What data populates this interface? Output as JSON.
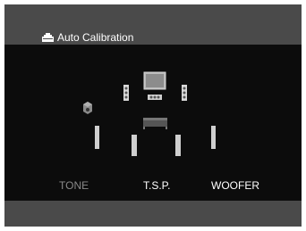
{
  "header": {
    "title": "Auto Calibration",
    "icon": "calibration-icon"
  },
  "speaker_layout": {
    "speakers": [
      "tv",
      "front-left",
      "front-right",
      "center",
      "front-high-left",
      "subwoofer",
      "surround-left",
      "surround-right",
      "surround-back-left",
      "surround-back-right",
      "listening-position"
    ]
  },
  "menu": {
    "items": [
      {
        "label": "TONE",
        "state": "dim"
      },
      {
        "label": "T.S.P.",
        "state": "active"
      },
      {
        "label": "WOOFER",
        "state": "active"
      }
    ]
  },
  "colors": {
    "header_bg": "#4a4a4a",
    "screen_bg": "#0c0c0c",
    "text_active": "#ffffff",
    "text_dim": "#8a8a8a"
  }
}
